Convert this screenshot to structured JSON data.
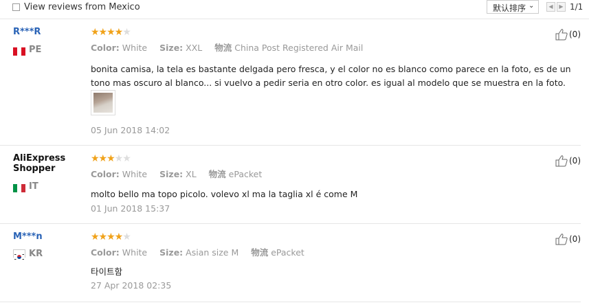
{
  "filter": {
    "mexico_label": "View reviews from Mexico"
  },
  "sort": {
    "label": "默认排序"
  },
  "pager": {
    "count": "1/1"
  },
  "labels": {
    "color": "Color:",
    "size": "Size:",
    "shipping": "物流"
  },
  "reviews": [
    {
      "user": "R***R",
      "country": "PE",
      "stars": 4,
      "color": "White",
      "size": "XXL",
      "shipping": "China Post Registered Air Mail",
      "text": "bonita camisa, la tela es bastante delgada pero fresca, y el color no es blanco como parece en la foto, es de un tono mas oscuro al blanco... si vuelvo a pedir seria en otro color. es igual al modelo que se muestra en la foto.",
      "date": "05 Jun 2018 14:02",
      "helpful": "(0)"
    },
    {
      "user": "AliExpress Shopper",
      "country": "IT",
      "stars": 3,
      "color": "White",
      "size": "XL",
      "shipping": "ePacket",
      "text": "molto bello ma topo picolo. volevo xl ma la taglia xl é come M",
      "date": "01 Jun 2018 15:37",
      "helpful": "(0)"
    },
    {
      "user": "M***n",
      "country": "KR",
      "stars": 4,
      "color": "White",
      "size": "Asian size M",
      "shipping": "ePacket",
      "text": "타이트함",
      "date": "27 Apr 2018 02:35",
      "helpful": "(0)"
    }
  ]
}
